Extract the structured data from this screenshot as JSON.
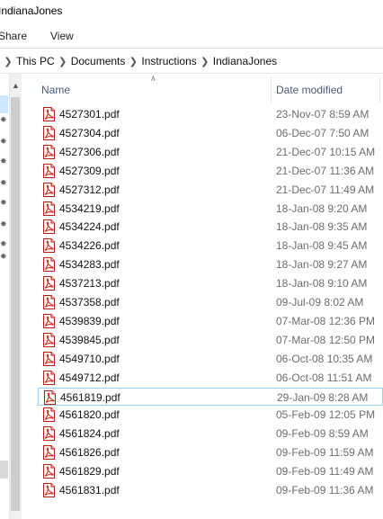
{
  "window": {
    "title": "IndianaJones"
  },
  "ribbon": {
    "tabs": [
      {
        "label": "Share"
      },
      {
        "label": "View"
      }
    ]
  },
  "address": {
    "crumbs": [
      "This PC",
      "Documents",
      "Instructions",
      "IndianaJones"
    ]
  },
  "columns": {
    "name": "Name",
    "date_modified": "Date modified"
  },
  "files": [
    {
      "name": "4527301.pdf",
      "date": "23-Nov-07 8:59 AM"
    },
    {
      "name": "4527304.pdf",
      "date": "06-Dec-07 7:50 AM"
    },
    {
      "name": "4527306.pdf",
      "date": "21-Dec-07 10:15 AM"
    },
    {
      "name": "4527309.pdf",
      "date": "21-Dec-07 11:36 AM"
    },
    {
      "name": "4527312.pdf",
      "date": "21-Dec-07 11:49 AM"
    },
    {
      "name": "4534219.pdf",
      "date": "18-Jan-08 9:20 AM"
    },
    {
      "name": "4534224.pdf",
      "date": "18-Jan-08 9:35 AM"
    },
    {
      "name": "4534226.pdf",
      "date": "18-Jan-08 9:45 AM"
    },
    {
      "name": "4534283.pdf",
      "date": "18-Jan-08 9:27 AM"
    },
    {
      "name": "4537213.pdf",
      "date": "18-Jan-08 9:10 AM"
    },
    {
      "name": "4537358.pdf",
      "date": "09-Jul-09 8:02 AM"
    },
    {
      "name": "4539839.pdf",
      "date": "07-Mar-08 12:36 PM"
    },
    {
      "name": "4539845.pdf",
      "date": "07-Mar-08 12:50 PM"
    },
    {
      "name": "4549710.pdf",
      "date": "06-Oct-08 10:35 AM"
    },
    {
      "name": "4549712.pdf",
      "date": "06-Oct-08 11:51 AM"
    },
    {
      "name": "4561819.pdf",
      "date": "29-Jan-09 8:28 AM"
    },
    {
      "name": "4561820.pdf",
      "date": "05-Feb-09 12:05 PM"
    },
    {
      "name": "4561824.pdf",
      "date": "09-Feb-09 8:59 AM"
    },
    {
      "name": "4561826.pdf",
      "date": "09-Feb-09 11:59 AM"
    },
    {
      "name": "4561829.pdf",
      "date": "09-Feb-09 11:49 AM"
    },
    {
      "name": "4561831.pdf",
      "date": "09-Feb-09 11:36 AM"
    }
  ],
  "focused_file": "4561819.pdf",
  "icons": {
    "file": "pdf-file-icon",
    "pin": "pin-icon",
    "sort": "sort-ascending-icon",
    "separator": "chevron-right-icon"
  },
  "colors": {
    "header_text": "#4a5a74",
    "date_text": "#6d6d6d",
    "focus_border": "#99d1ff",
    "pdf_red": "#d42b1e"
  }
}
